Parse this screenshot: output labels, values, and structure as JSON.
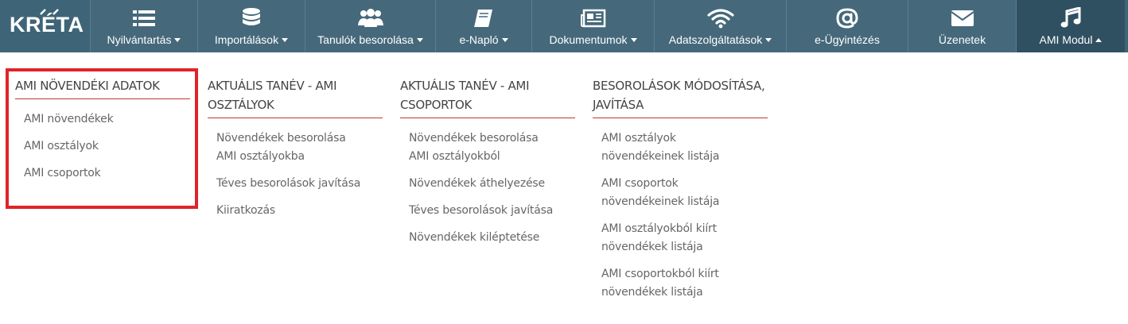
{
  "logo": {
    "text": "KRÉTA"
  },
  "nav": [
    {
      "id": "nyilvantartas",
      "label": "Nyilvántartás",
      "icon": "list-icon",
      "caret": "down"
    },
    {
      "id": "importalasok",
      "label": "Importálások",
      "icon": "database-icon",
      "caret": "down"
    },
    {
      "id": "tanulok-besorolasa",
      "label": "Tanulók besorolása",
      "icon": "users-icon",
      "caret": "down"
    },
    {
      "id": "e-naplo",
      "label": "e-Napló",
      "icon": "book-icon",
      "caret": "down"
    },
    {
      "id": "dokumentumok",
      "label": "Dokumentumok",
      "icon": "newspaper-icon",
      "caret": "down"
    },
    {
      "id": "adatszolgaltatasok",
      "label": "Adatszolgáltatások",
      "icon": "wifi-icon",
      "caret": "down"
    },
    {
      "id": "e-ugyintezes",
      "label": "e-Ügyintézés",
      "icon": "at-icon",
      "caret": ""
    },
    {
      "id": "uzenetek",
      "label": "Üzenetek",
      "icon": "envelope-icon",
      "caret": ""
    },
    {
      "id": "ami-modul",
      "label": "AMI Modul",
      "icon": "music-icon",
      "caret": "up"
    }
  ],
  "menu": {
    "col1": {
      "title": "AMI NÖVENDÉKI ADATOK",
      "links": [
        "AMI növendékek",
        "AMI osztályok",
        "AMI csoportok"
      ]
    },
    "col2": {
      "title_line1": "AKTUÁLIS TANÉV - AMI",
      "title_line2": "OSZTÁLYOK",
      "links": [
        {
          "l1": "Növendékek besorolása",
          "l2": "AMI osztályokba"
        },
        {
          "l1": "Téves besorolások javítása",
          "l2": ""
        },
        {
          "l1": "Kiiratkozás",
          "l2": ""
        }
      ]
    },
    "col3": {
      "title_line1": "AKTUÁLIS TANÉV - AMI",
      "title_line2": "CSOPORTOK",
      "links": [
        {
          "l1": "Növendékek besorolása",
          "l2": "AMI osztályokból"
        },
        {
          "l1": "Növendékek áthelyezése",
          "l2": ""
        },
        {
          "l1": "Téves besorolások javítása",
          "l2": ""
        },
        {
          "l1": "Növendékek kiléptetése",
          "l2": ""
        }
      ]
    },
    "col4": {
      "title_line1": "BESOROLÁSOK MÓDOSÍTÁSA,",
      "title_line2": "JAVÍTÁSA",
      "links": [
        {
          "l1": "AMI osztályok",
          "l2": "növendékeinek listája"
        },
        {
          "l1": "AMI csoportok",
          "l2": "növendékeinek listája"
        },
        {
          "l1": "AMI osztályokból kiírt",
          "l2": "növendékek listája"
        },
        {
          "l1": "AMI csoportokból kiírt",
          "l2": "növendékek listája"
        }
      ]
    }
  },
  "colors": {
    "nav_bg": "#45697b",
    "nav_active": "#2f5061",
    "rule": "#c0392b",
    "highlight": "#e0232a"
  }
}
